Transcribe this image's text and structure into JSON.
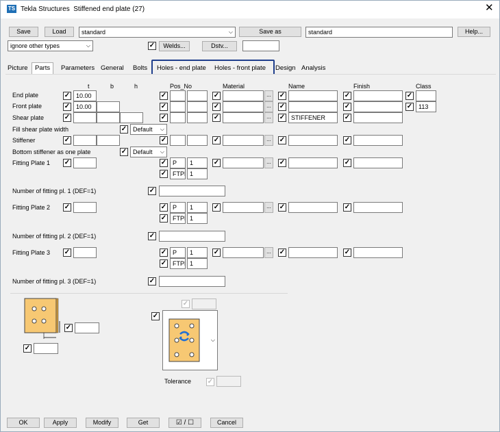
{
  "window": {
    "app_name": "Tekla Structures",
    "dialog_title": "Stiffened end plate (27)",
    "app_icon": "TS"
  },
  "toolbar": {
    "save": "Save",
    "load": "Load",
    "attr_value": "standard",
    "save_as": "Save as",
    "save_as_value": "standard",
    "help": "Help...",
    "ignore_select": "ignore other types",
    "welds": "Welds...",
    "dstv": "Dstv...",
    "dstv_value": ""
  },
  "tabs": [
    "Picture",
    "Parts",
    "Parameters",
    "General",
    "Bolts",
    "Holes - end plate",
    "Holes - front plate",
    "Design",
    "Analysis"
  ],
  "columns": {
    "t": "t",
    "b": "b",
    "h": "h",
    "pos_no": "Pos_No",
    "material": "Material",
    "name": "Name",
    "finish": "Finish",
    "class": "Class"
  },
  "rows": {
    "end_plate": {
      "label": "End plate",
      "t": "10.00",
      "class": ""
    },
    "front_plate": {
      "label": "Front plate",
      "t": "10.00",
      "class": "113"
    },
    "shear_plate": {
      "label": "Shear plate",
      "name": "STIFFENER"
    },
    "fill_shear": {
      "label": "Fill shear plate width",
      "option": "Default"
    },
    "stiffener": {
      "label": "Stiffener"
    },
    "bottom_stiffener": {
      "label": "Bottom stiffener as one plate",
      "option": "Default"
    },
    "fitting1": {
      "label": "Fitting Plate 1",
      "prefix": "P",
      "start": "1",
      "prefix2": "FTPL",
      "start2": "1"
    },
    "num_fit1": {
      "label": "Number of fitting pl. 1 (DEF=1)"
    },
    "fitting2": {
      "label": "Fitting Plate 2",
      "prefix": "P",
      "start": "1",
      "prefix2": "FTPL",
      "start2": "1"
    },
    "num_fit2": {
      "label": "Number of fitting pl. 2 (DEF=1)"
    },
    "fitting3": {
      "label": "Fitting Plate 3",
      "prefix": "P",
      "start": "1",
      "prefix2": "FTPL",
      "start2": "1"
    },
    "num_fit3": {
      "label": "Number of fitting pl. 3 (DEF=1)"
    }
  },
  "tolerance": {
    "label": "Tolerance"
  },
  "bottom": {
    "ok": "OK",
    "apply": "Apply",
    "modify": "Modify",
    "get": "Get",
    "toggle": "☑ / ☐",
    "cancel": "Cancel"
  },
  "colors": {
    "plate": "#f7c873",
    "bolt": "#ffffff",
    "highlight": "#1f3e8c"
  }
}
